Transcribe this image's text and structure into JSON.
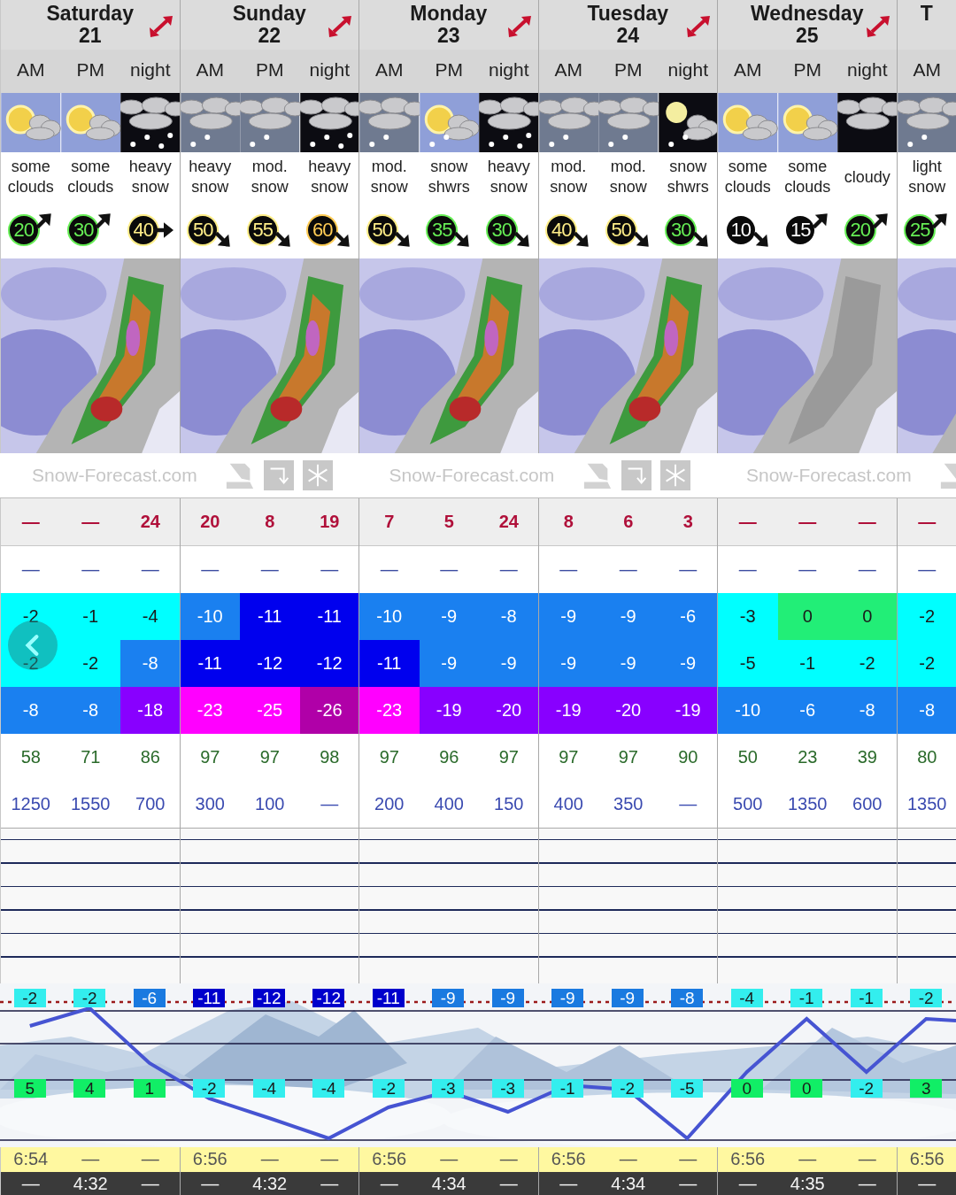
{
  "days": [
    {
      "name": "Saturday",
      "date": "21",
      "periods": [
        {
          "period": "AM",
          "sky": {
            "kind": "sun-cloud"
          },
          "desc": "some clouds",
          "wind": {
            "value": "20",
            "color": "#66ee55",
            "kind": "ne"
          },
          "snow": "—",
          "rain": "—",
          "tmax": {
            "value": "-2",
            "color": "#00ffff"
          },
          "tmin": {
            "value": "-2",
            "color": "#00ffff"
          },
          "chill": {
            "value": "-8",
            "color": "#1a80f0"
          },
          "humidity": "58",
          "freezing": "1250",
          "chart_top": {
            "value": "-2",
            "color": "#33eeee"
          },
          "chart_mid": {
            "value": "5",
            "color": "#11ee66"
          },
          "sunrise": "6:54",
          "sunset": "—"
        },
        {
          "period": "PM",
          "sky": {
            "kind": "sun-cloud"
          },
          "desc": "some clouds",
          "wind": {
            "value": "30",
            "color": "#66ee55",
            "kind": "ne"
          },
          "snow": "—",
          "rain": "—",
          "tmax": {
            "value": "-1",
            "color": "#00ffff"
          },
          "tmin": {
            "value": "-2",
            "color": "#00ffff"
          },
          "chill": {
            "value": "-8",
            "color": "#1a80f0"
          },
          "humidity": "71",
          "freezing": "1550",
          "chart_top": {
            "value": "-2",
            "color": "#33eeee"
          },
          "chart_mid": {
            "value": "4",
            "color": "#11ee66"
          },
          "sunrise": "—",
          "sunset": "4:32"
        },
        {
          "period": "night",
          "sky": {
            "kind": "snow-night"
          },
          "desc": "heavy snow",
          "wind": {
            "value": "40",
            "color": "#ffee88",
            "kind": "e"
          },
          "snow": "24",
          "rain": "—",
          "tmax": {
            "value": "-4",
            "color": "#00ffff"
          },
          "tmin": {
            "value": "-8",
            "color": "#1a80f0"
          },
          "chill": {
            "value": "-18",
            "color": "#8800ff"
          },
          "humidity": "86",
          "freezing": "700",
          "chart_top": {
            "value": "-6",
            "color": "#1a7ae0"
          },
          "chart_mid": {
            "value": "1",
            "color": "#11ee66"
          },
          "sunrise": "—",
          "sunset": "—"
        }
      ]
    },
    {
      "name": "Sunday",
      "date": "22",
      "periods": [
        {
          "period": "AM",
          "sky": {
            "kind": "snow-day"
          },
          "desc": "heavy snow",
          "wind": {
            "value": "50",
            "color": "#ffee88",
            "kind": "se"
          },
          "snow": "20",
          "rain": "—",
          "tmax": {
            "value": "-10",
            "color": "#1a80f0"
          },
          "tmin": {
            "value": "-11",
            "color": "#0000ee"
          },
          "chill": {
            "value": "-23",
            "color": "#ff00ff"
          },
          "humidity": "97",
          "freezing": "300",
          "chart_top": {
            "value": "-11",
            "color": "#0000cc"
          },
          "chart_mid": {
            "value": "-2",
            "color": "#33eeee"
          },
          "sunrise": "6:56",
          "sunset": "—"
        },
        {
          "period": "PM",
          "sky": {
            "kind": "snow-day"
          },
          "desc": "mod. snow",
          "wind": {
            "value": "55",
            "color": "#ffee88",
            "kind": "se"
          },
          "snow": "8",
          "rain": "—",
          "tmax": {
            "value": "-11",
            "color": "#0000ee"
          },
          "tmin": {
            "value": "-12",
            "color": "#0000ee"
          },
          "chill": {
            "value": "-25",
            "color": "#ff00ff"
          },
          "humidity": "97",
          "freezing": "100",
          "chart_top": {
            "value": "-12",
            "color": "#0000cc"
          },
          "chart_mid": {
            "value": "-4",
            "color": "#33eeee"
          },
          "sunrise": "—",
          "sunset": "4:32"
        },
        {
          "period": "night",
          "sky": {
            "kind": "snow-night"
          },
          "desc": "heavy snow",
          "wind": {
            "value": "60",
            "color": "#ffcc55",
            "kind": "se"
          },
          "snow": "19",
          "rain": "—",
          "tmax": {
            "value": "-11",
            "color": "#0000ee"
          },
          "tmin": {
            "value": "-12",
            "color": "#0000ee"
          },
          "chill": {
            "value": "-26",
            "color": "#b000a8"
          },
          "humidity": "98",
          "freezing": "—",
          "chart_top": {
            "value": "-12",
            "color": "#0000cc"
          },
          "chart_mid": {
            "value": "-4",
            "color": "#33eeee"
          },
          "sunrise": "—",
          "sunset": "—"
        }
      ]
    },
    {
      "name": "Monday",
      "date": "23",
      "periods": [
        {
          "period": "AM",
          "sky": {
            "kind": "snow-day"
          },
          "desc": "mod. snow",
          "wind": {
            "value": "50",
            "color": "#ffee88",
            "kind": "se"
          },
          "snow": "7",
          "rain": "—",
          "tmax": {
            "value": "-10",
            "color": "#1a80f0"
          },
          "tmin": {
            "value": "-11",
            "color": "#0000ee"
          },
          "chill": {
            "value": "-23",
            "color": "#ff00ff"
          },
          "humidity": "97",
          "freezing": "200",
          "chart_top": {
            "value": "-11",
            "color": "#0000cc"
          },
          "chart_mid": {
            "value": "-2",
            "color": "#33eeee"
          },
          "sunrise": "6:56",
          "sunset": "—"
        },
        {
          "period": "PM",
          "sky": {
            "kind": "sun-snow"
          },
          "desc": "snow shwrs",
          "wind": {
            "value": "35",
            "color": "#66ee55",
            "kind": "se"
          },
          "snow": "5",
          "rain": "—",
          "tmax": {
            "value": "-9",
            "color": "#1a80f0"
          },
          "tmin": {
            "value": "-9",
            "color": "#1a80f0"
          },
          "chill": {
            "value": "-19",
            "color": "#8800ff"
          },
          "humidity": "96",
          "freezing": "400",
          "chart_top": {
            "value": "-9",
            "color": "#1a7ae0"
          },
          "chart_mid": {
            "value": "-3",
            "color": "#33eeee"
          },
          "sunrise": "—",
          "sunset": "4:34"
        },
        {
          "period": "night",
          "sky": {
            "kind": "snow-night"
          },
          "desc": "heavy snow",
          "wind": {
            "value": "30",
            "color": "#66ee55",
            "kind": "se"
          },
          "snow": "24",
          "rain": "—",
          "tmax": {
            "value": "-8",
            "color": "#1a80f0"
          },
          "tmin": {
            "value": "-9",
            "color": "#1a80f0"
          },
          "chill": {
            "value": "-20",
            "color": "#8800ff"
          },
          "humidity": "97",
          "freezing": "150",
          "chart_top": {
            "value": "-9",
            "color": "#1a7ae0"
          },
          "chart_mid": {
            "value": "-3",
            "color": "#33eeee"
          },
          "sunrise": "—",
          "sunset": "—"
        }
      ]
    },
    {
      "name": "Tuesday",
      "date": "24",
      "periods": [
        {
          "period": "AM",
          "sky": {
            "kind": "snow-day"
          },
          "desc": "mod. snow",
          "wind": {
            "value": "40",
            "color": "#ffee88",
            "kind": "se"
          },
          "snow": "8",
          "rain": "—",
          "tmax": {
            "value": "-9",
            "color": "#1a80f0"
          },
          "tmin": {
            "value": "-9",
            "color": "#1a80f0"
          },
          "chill": {
            "value": "-19",
            "color": "#8800ff"
          },
          "humidity": "97",
          "freezing": "400",
          "chart_top": {
            "value": "-9",
            "color": "#1a7ae0"
          },
          "chart_mid": {
            "value": "-1",
            "color": "#33eeee"
          },
          "sunrise": "6:56",
          "sunset": "—"
        },
        {
          "period": "PM",
          "sky": {
            "kind": "snow-day"
          },
          "desc": "mod. snow",
          "wind": {
            "value": "50",
            "color": "#ffee88",
            "kind": "se"
          },
          "snow": "6",
          "rain": "—",
          "tmax": {
            "value": "-9",
            "color": "#1a80f0"
          },
          "tmin": {
            "value": "-9",
            "color": "#1a80f0"
          },
          "chill": {
            "value": "-20",
            "color": "#8800ff"
          },
          "humidity": "97",
          "freezing": "350",
          "chart_top": {
            "value": "-9",
            "color": "#1a7ae0"
          },
          "chart_mid": {
            "value": "-2",
            "color": "#33eeee"
          },
          "sunrise": "—",
          "sunset": "4:34"
        },
        {
          "period": "night",
          "sky": {
            "kind": "moon-snow"
          },
          "desc": "snow shwrs",
          "wind": {
            "value": "30",
            "color": "#66ee55",
            "kind": "se"
          },
          "snow": "3",
          "rain": "—",
          "tmax": {
            "value": "-6",
            "color": "#1a80f0"
          },
          "tmin": {
            "value": "-9",
            "color": "#1a80f0"
          },
          "chill": {
            "value": "-19",
            "color": "#8800ff"
          },
          "humidity": "90",
          "freezing": "—",
          "chart_top": {
            "value": "-8",
            "color": "#1a7ae0"
          },
          "chart_mid": {
            "value": "-5",
            "color": "#33eeee"
          },
          "sunrise": "—",
          "sunset": "—"
        }
      ]
    },
    {
      "name": "Wednesday",
      "date": "25",
      "periods": [
        {
          "period": "AM",
          "sky": {
            "kind": "sun-cloud"
          },
          "desc": "some clouds",
          "wind": {
            "value": "10",
            "color": "#ffffff",
            "kind": "se"
          },
          "snow": "—",
          "rain": "—",
          "tmax": {
            "value": "-3",
            "color": "#00ffff"
          },
          "tmin": {
            "value": "-5",
            "color": "#00ffff"
          },
          "chill": {
            "value": "-10",
            "color": "#1a80f0"
          },
          "humidity": "50",
          "freezing": "500",
          "chart_top": {
            "value": "-4",
            "color": "#33eeee"
          },
          "chart_mid": {
            "value": "0",
            "color": "#11ee66"
          },
          "sunrise": "6:56",
          "sunset": "—"
        },
        {
          "period": "PM",
          "sky": {
            "kind": "sun-cloud"
          },
          "desc": "some clouds",
          "wind": {
            "value": "15",
            "color": "#ffffff",
            "kind": "ne"
          },
          "snow": "—",
          "rain": "—",
          "tmax": {
            "value": "0",
            "color": "#22ee77"
          },
          "tmin": {
            "value": "-1",
            "color": "#00ffff"
          },
          "chill": {
            "value": "-6",
            "color": "#1a80f0"
          },
          "humidity": "23",
          "freezing": "1350",
          "chart_top": {
            "value": "-1",
            "color": "#33eeee"
          },
          "chart_mid": {
            "value": "0",
            "color": "#11ee66"
          },
          "sunrise": "—",
          "sunset": "4:35"
        },
        {
          "period": "night",
          "sky": {
            "kind": "cloud-night"
          },
          "desc": "cloudy",
          "wind": {
            "value": "20",
            "color": "#66ee55",
            "kind": "ne"
          },
          "snow": "—",
          "rain": "—",
          "tmax": {
            "value": "0",
            "color": "#22ee77"
          },
          "tmin": {
            "value": "-2",
            "color": "#00ffff"
          },
          "chill": {
            "value": "-8",
            "color": "#1a80f0"
          },
          "humidity": "39",
          "freezing": "600",
          "chart_top": {
            "value": "-1",
            "color": "#33eeee"
          },
          "chart_mid": {
            "value": "-2",
            "color": "#33eeee"
          },
          "sunrise": "—",
          "sunset": "—"
        }
      ]
    },
    {
      "name": "T",
      "periods": [
        {
          "period": "AM",
          "sky": {
            "kind": "snow-day"
          },
          "desc": "light snow",
          "wind": {
            "value": "25",
            "color": "#66ee55",
            "kind": "ne"
          },
          "snow": "—",
          "rain": "—",
          "tmax": {
            "value": "-2",
            "color": "#00ffff"
          },
          "tmin": {
            "value": "-2",
            "color": "#00ffff"
          },
          "chill": {
            "value": "-8",
            "color": "#1a80f0"
          },
          "humidity": "80",
          "freezing": "1350",
          "chart_top": {
            "value": "-2",
            "color": "#33eeee"
          },
          "chart_mid": {
            "value": "3",
            "color": "#11ee66"
          },
          "sunrise": "6:56",
          "sunset": "—"
        }
      ]
    }
  ],
  "logos": [
    "Snow-Forecast.com",
    "Snow-Forecast.com",
    "Snow-Forecast.com"
  ]
}
